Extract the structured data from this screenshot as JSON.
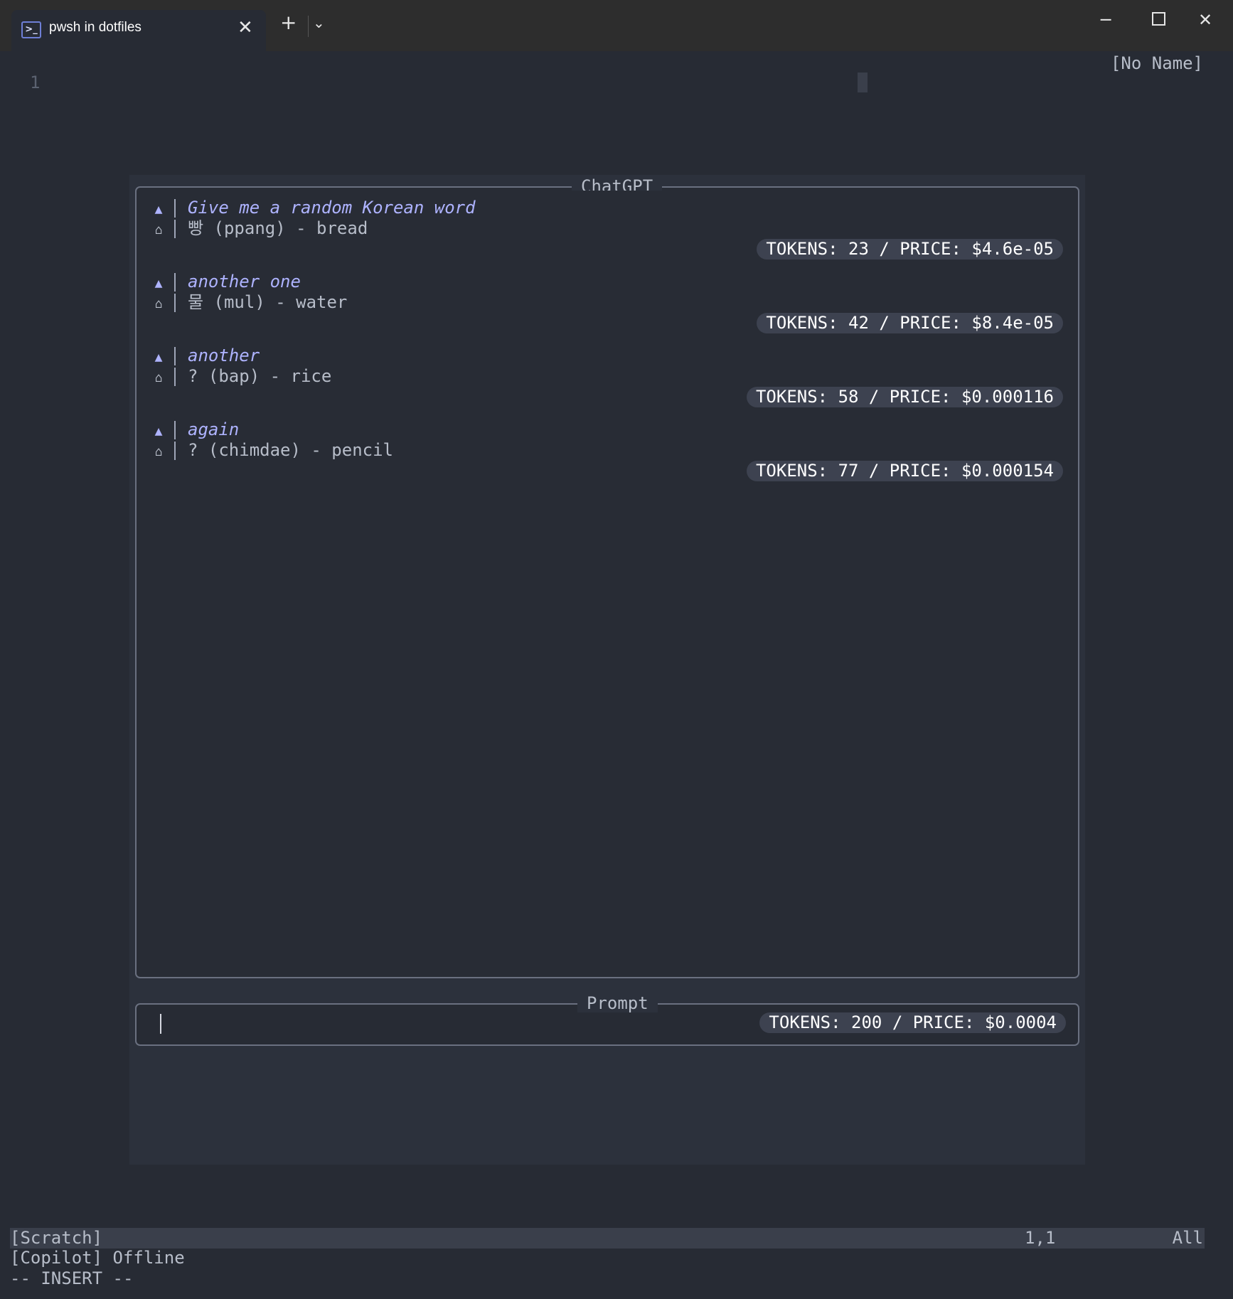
{
  "titlebar": {
    "tab_title": "pwsh in dotfiles",
    "tab_close": "✕",
    "new_tab": "+",
    "dropdown": "⌄",
    "minimize": "─",
    "close": "✕"
  },
  "editor": {
    "buffer_name": "[No Name]",
    "line_number": "1"
  },
  "chat": {
    "title": "ChatGPT",
    "messages": [
      {
        "role": "user",
        "icon": "user-icon",
        "text": "Give me a random Korean word"
      },
      {
        "role": "assistant",
        "icon": "robot-icon",
        "text": "빵 (ppang) - bread",
        "usage": "TOKENS: 23 / PRICE: $4.6e-05"
      },
      {
        "role": "user",
        "icon": "user-icon",
        "text": "another one"
      },
      {
        "role": "assistant",
        "icon": "robot-icon",
        "text": "물 (mul) - water",
        "usage": "TOKENS: 42 / PRICE: $8.4e-05"
      },
      {
        "role": "user",
        "icon": "user-icon",
        "text": "another"
      },
      {
        "role": "assistant",
        "icon": "robot-icon",
        "text": "? (bap) - rice",
        "usage": "TOKENS: 58 / PRICE: $0.000116"
      },
      {
        "role": "user",
        "icon": "user-icon",
        "text": "again"
      },
      {
        "role": "assistant",
        "icon": "robot-icon",
        "text": "? (chimdae) - pencil",
        "usage": "TOKENS: 77 / PRICE: $0.000154"
      }
    ]
  },
  "prompt": {
    "title": "Prompt",
    "value": "",
    "usage": "TOKENS: 200 / PRICE: $0.0004"
  },
  "statusline": {
    "left": "[Scratch]",
    "position": "1,1",
    "scroll": "All"
  },
  "messages_area": {
    "copilot": "[Copilot] Offline",
    "mode": "-- INSERT --"
  }
}
